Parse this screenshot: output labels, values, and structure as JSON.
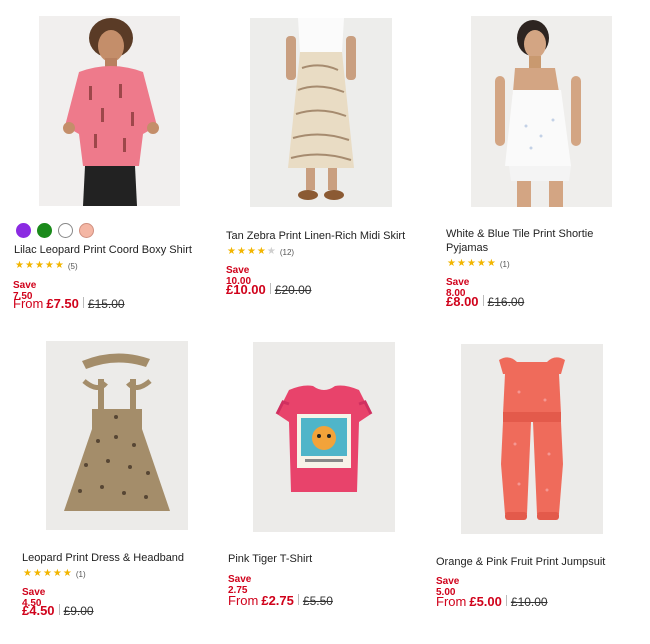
{
  "products": [
    {
      "title": "Lilac Leopard Print Coord Boxy Shirt",
      "swatches": [
        "#8b2be2",
        "#1a8a1a",
        "#ffffff",
        "#f4b6a4"
      ],
      "stars": 5,
      "reviews": "(5)",
      "save": "Save 7.50",
      "from": "From",
      "price": "£7.50",
      "was": "£15.00",
      "image_icon": "pink-giraffe-shirt-photo"
    },
    {
      "title": "Tan Zebra Print Linen-Rich Midi Skirt",
      "stars": 4,
      "reviews": "(12)",
      "save": "Save 10.00",
      "from": "",
      "price": "£10.00",
      "was": "£20.00",
      "image_icon": "zebra-skirt-photo"
    },
    {
      "title": "White & Blue Tile Print Shortie Pyjamas",
      "stars": 5,
      "reviews": "(1)",
      "save": "Save 8.00",
      "from": "",
      "price": "£8.00",
      "was": "£16.00",
      "image_icon": "white-pyjamas-photo"
    },
    {
      "title": "Leopard Print Dress & Headband",
      "stars": 5,
      "reviews": "(1)",
      "save": "Save 4.50",
      "from": "",
      "price": "£4.50",
      "was": "£9.00",
      "image_icon": "leopard-dress-photo"
    },
    {
      "title": "Pink Tiger T-Shirt",
      "save": "Save 2.75",
      "from": "From",
      "price": "£2.75",
      "was": "£5.50",
      "image_icon": "pink-tiger-tshirt-photo"
    },
    {
      "title": "Orange & Pink Fruit Print Jumpsuit",
      "save": "Save 5.00",
      "from": "From",
      "price": "£5.00",
      "was": "£10.00",
      "image_icon": "orange-jumpsuit-photo"
    }
  ]
}
